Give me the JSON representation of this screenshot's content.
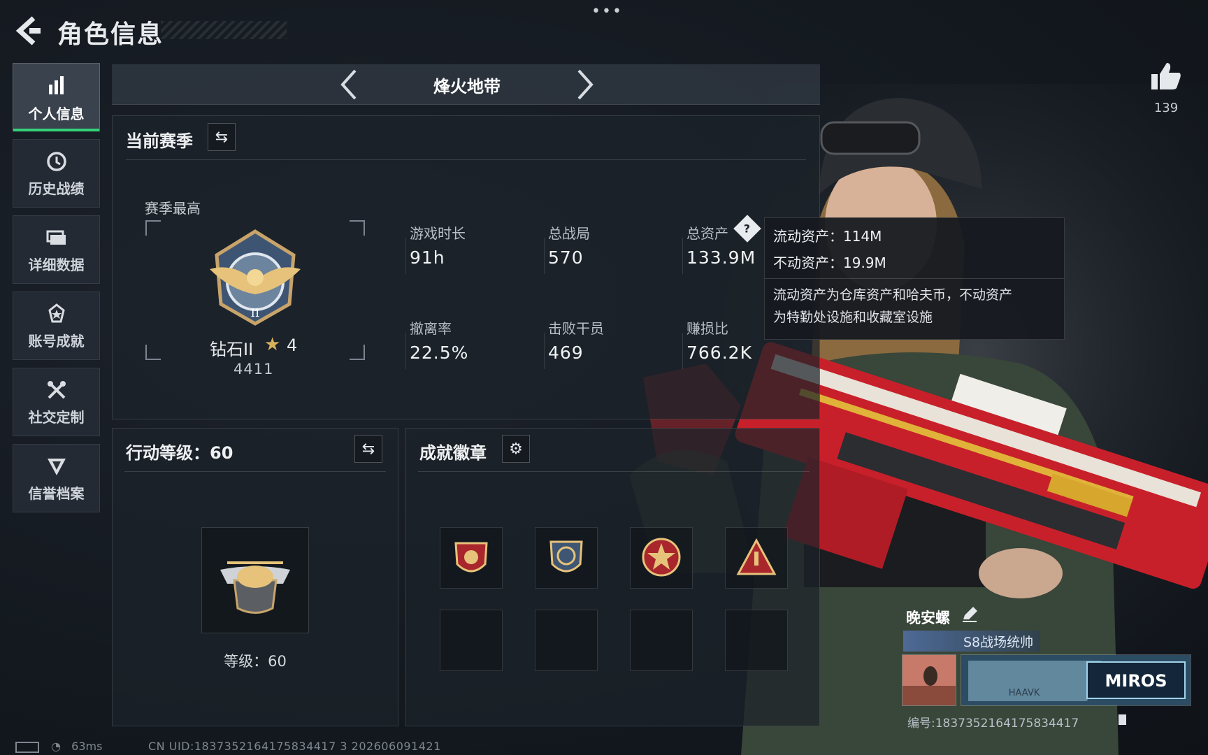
{
  "header": {
    "title": "角色信息",
    "back_icon": "chevron-left-icon",
    "more_icon": "more-dots-icon",
    "more_text": "•••"
  },
  "sidebar": {
    "items": [
      {
        "label": "个人信息",
        "icon": "bar-chart-icon",
        "active": true
      },
      {
        "label": "历史战绩",
        "icon": "clock-history-icon",
        "active": false
      },
      {
        "label": "详细数据",
        "icon": "folder-icon",
        "active": false
      },
      {
        "label": "账号成就",
        "icon": "medal-icon",
        "active": false
      },
      {
        "label": "社交定制",
        "icon": "wrench-tools-icon",
        "active": false
      },
      {
        "label": "信誉档案",
        "icon": "shield-emblem-icon",
        "active": false
      }
    ]
  },
  "mode": {
    "title": "烽火地带"
  },
  "season": {
    "title": "当前赛季",
    "best_label": "赛季最高",
    "rank_name": "钻石II",
    "rank_stars": "4",
    "rank_score": "4411",
    "stats": [
      {
        "label": "游戏时长",
        "value": "91h"
      },
      {
        "label": "总战局",
        "value": "570"
      },
      {
        "label": "总资产",
        "value": "133.9M"
      },
      {
        "label": "撤离率",
        "value": "22.5%"
      },
      {
        "label": "击败干员",
        "value": "469"
      },
      {
        "label": "赚损比",
        "value": "766.2K"
      }
    ]
  },
  "tooltip": {
    "liquid": "流动资产：114M",
    "fixed": "不动资产：19.9M",
    "desc_line1": "流动资产为仓库资产和哈夫币，不动资产",
    "desc_line2": "为特勤处设施和收藏室设施"
  },
  "level": {
    "title": "行动等级：60",
    "level_text": "等级：60"
  },
  "achievements": {
    "title": "成就徽章",
    "badges": [
      "red-shield-badge-icon",
      "anchor-badge-icon",
      "star-skull-badge-icon",
      "warning-triangle-badge-icon"
    ],
    "empty_slots": 4
  },
  "player": {
    "likes": "139",
    "name": "晚安螺",
    "title": "S8战场统帅",
    "card_logo": "MIROS",
    "card_sub": "HAAVK",
    "id_text": "编号:1837352164175834417"
  },
  "status": {
    "ping": "63ms",
    "uid": "CN UID:1837352164175834417 3 202606091421"
  },
  "colors": {
    "accent_green": "#35d27a",
    "rank_star": "#d8b25a",
    "weapon_red": "#c8202a"
  }
}
